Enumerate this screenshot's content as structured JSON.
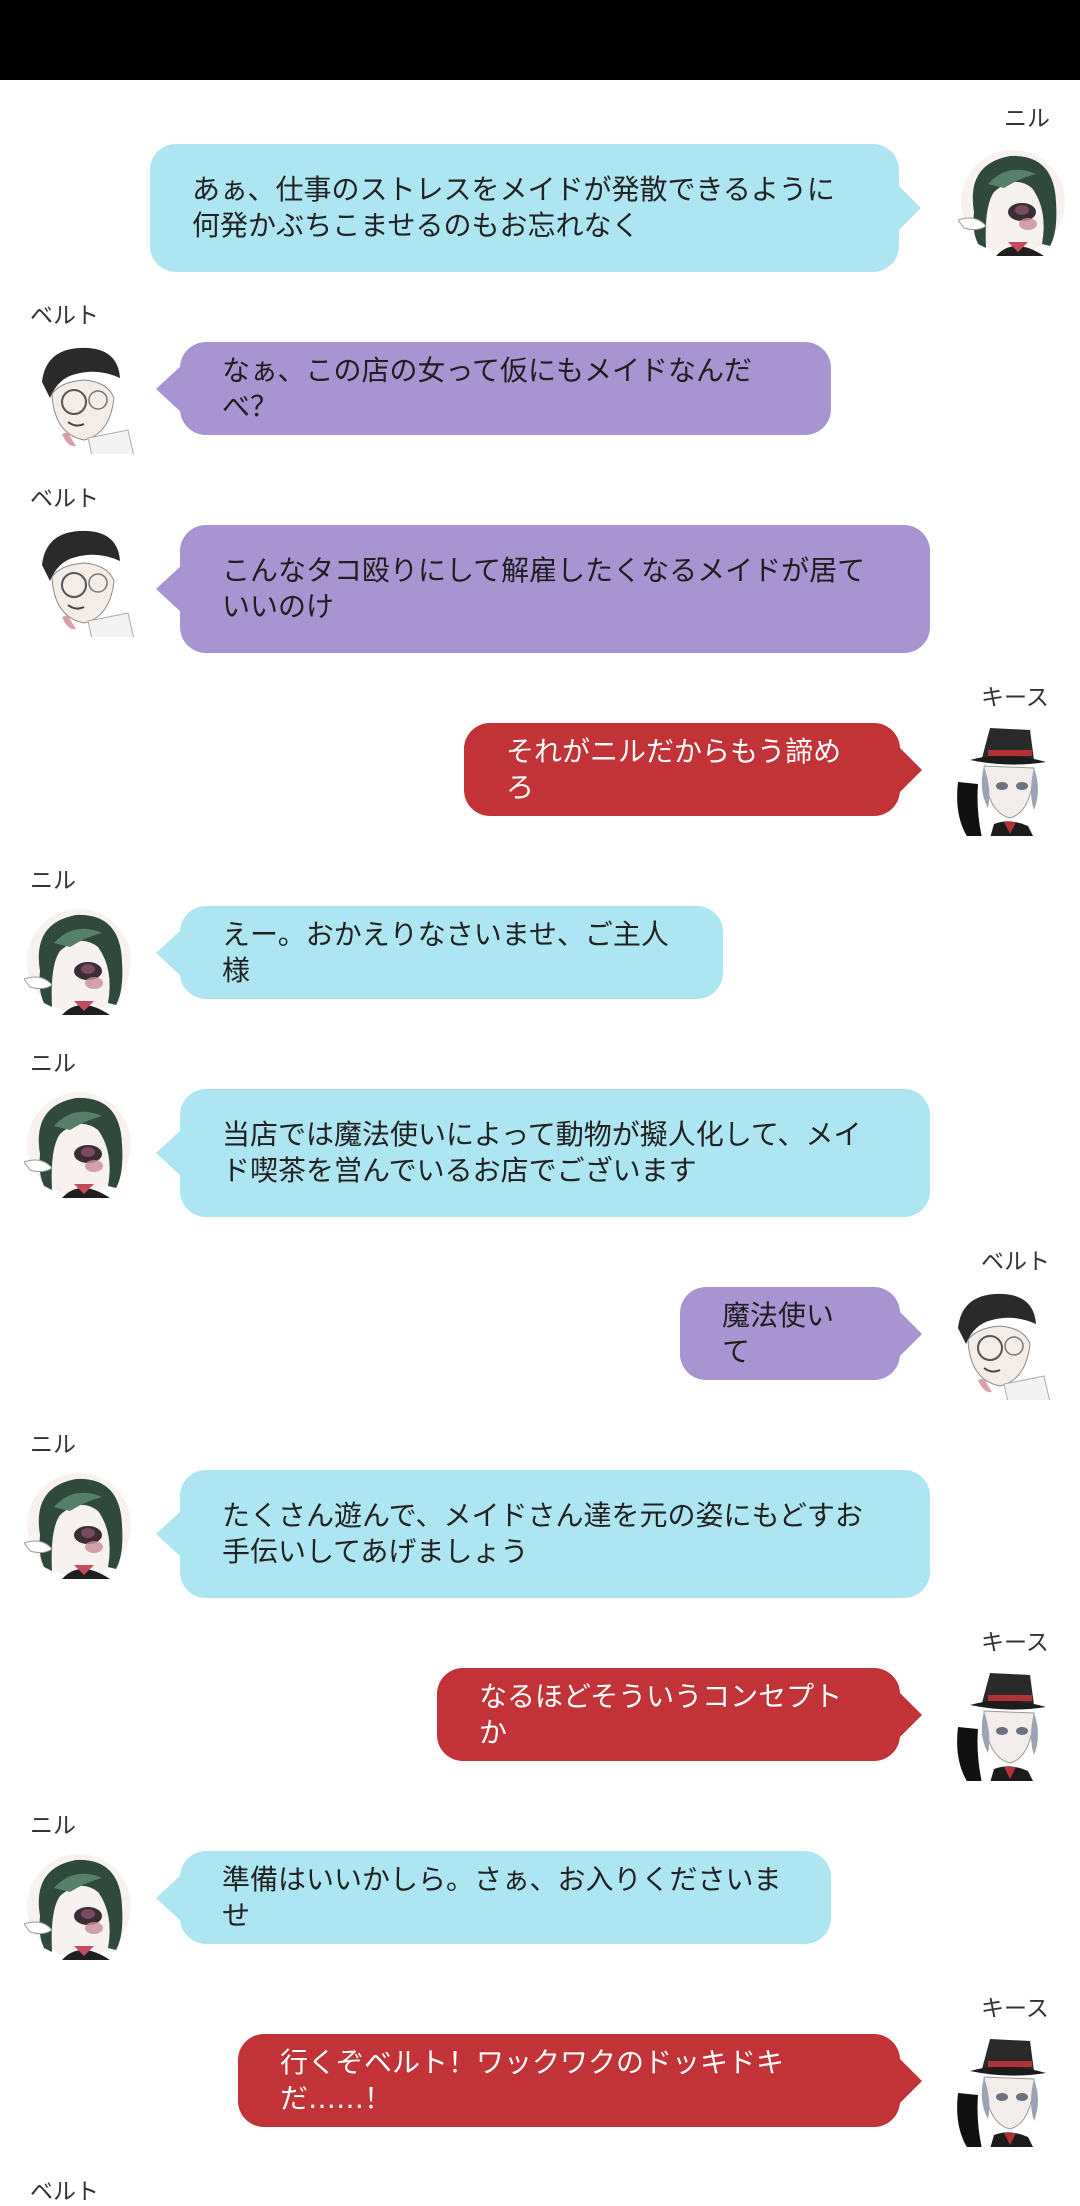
{
  "colors": {
    "top_bar": "#000000",
    "bubble_nil": "#ade5f2",
    "bubble_belt": "#a794d1",
    "bubble_keith": "#c23337"
  },
  "messages": [
    {
      "speaker": "ニル",
      "text": "あぁ、仕事のストレスをメイドが発散できるように何発かぶちこませるのもお忘れなく"
    },
    {
      "speaker": "ベルト",
      "text": "なぁ、この店の女って仮にもメイドなんだべ？"
    },
    {
      "speaker": "ベルト",
      "text": "こんなタコ殴りにして解雇したくなるメイドが居ていいのけ"
    },
    {
      "speaker": "キース",
      "text": "それがニルだからもう諦めろ"
    },
    {
      "speaker": "ニル",
      "text": "えー。おかえりなさいませ、ご主人様"
    },
    {
      "speaker": "ニル",
      "text": "当店では魔法使いによって動物が擬人化して、メイド喫茶を営んでいるお店でございます"
    },
    {
      "speaker": "ベルト",
      "text": "魔法使いて"
    },
    {
      "speaker": "ニル",
      "text": "たくさん遊んで、メイドさん達を元の姿にもどすお手伝いしてあげましょう"
    },
    {
      "speaker": "キース",
      "text": "なるほどそういうコンセプトか"
    },
    {
      "speaker": "ニル",
      "text": "準備はいいかしら。さぁ、お入りくださいませ"
    },
    {
      "speaker": "キース",
      "text": "行くぞベルト！ワックワクのドッキドキだ……！"
    },
    {
      "speaker": "ベルト",
      "text": ""
    }
  ]
}
